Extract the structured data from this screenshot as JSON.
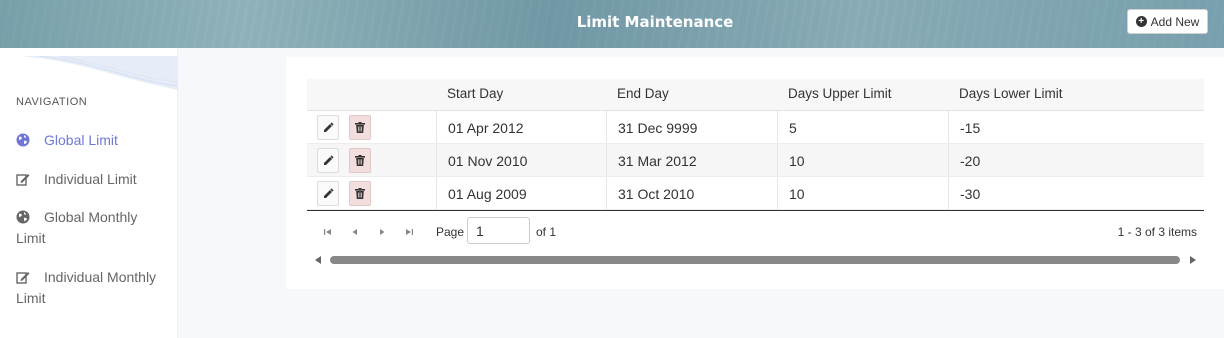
{
  "header": {
    "title": "Limit Maintenance",
    "add_new_label": "Add New"
  },
  "sidebar": {
    "heading": "NAVIGATION",
    "items": [
      {
        "label": "Global Limit",
        "icon": "globe-icon",
        "active": true
      },
      {
        "label": "Individual Limit",
        "icon": "edit-icon",
        "active": false
      },
      {
        "label": "Global Monthly Limit",
        "icon": "globe-icon",
        "active": false
      },
      {
        "label": "Individual Monthly Limit",
        "icon": "edit-icon",
        "active": false
      }
    ]
  },
  "grid": {
    "columns": [
      "",
      "Start Day",
      "End Day",
      "Days Upper Limit",
      "Days Lower Limit"
    ],
    "rows": [
      {
        "start": "01 Apr 2012",
        "end": "31 Dec 9999",
        "upper": "5",
        "lower": "-15"
      },
      {
        "start": "01 Nov 2010",
        "end": "31 Mar 2012",
        "upper": "10",
        "lower": "-20"
      },
      {
        "start": "01 Aug 2009",
        "end": "31 Oct 2010",
        "upper": "10",
        "lower": "-30"
      }
    ]
  },
  "pager": {
    "page_label": "Page",
    "page_value": "1",
    "of_label": "of 1",
    "info": "1 - 3 of 3 items"
  },
  "colors": {
    "accent": "#6f78d6",
    "delete_bg": "#f3dedd"
  }
}
